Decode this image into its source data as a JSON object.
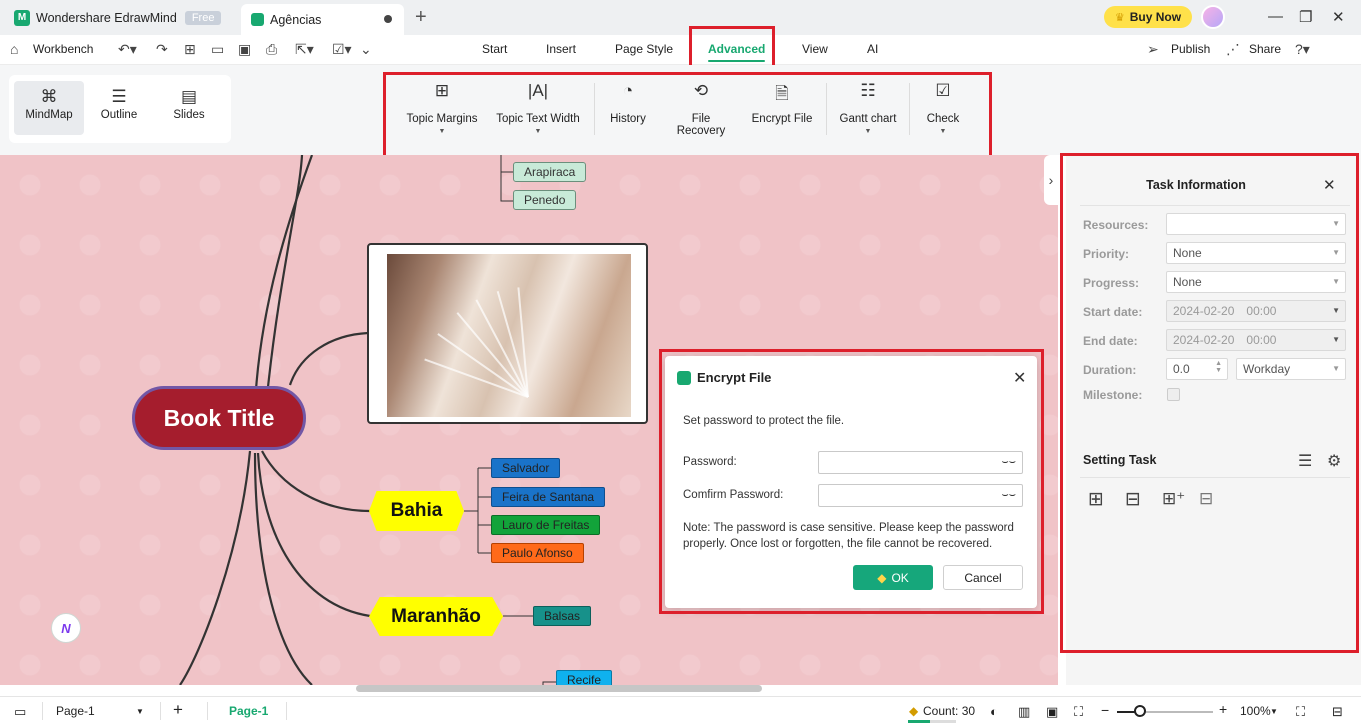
{
  "titlebar": {
    "app_name": "Wondershare EdrawMind",
    "plan_badge": "Free",
    "doc_tab": "Agências",
    "new_tab_icon": "plus-icon",
    "buy_now": "Buy Now"
  },
  "menubar": {
    "workbench": "Workbench",
    "tabs": [
      {
        "label": "Start"
      },
      {
        "label": "Insert"
      },
      {
        "label": "Page Style"
      },
      {
        "label": "Advanced"
      },
      {
        "label": "View"
      },
      {
        "label": "AI"
      }
    ],
    "active_tab": "Advanced",
    "publish": "Publish",
    "share": "Share"
  },
  "ribbon": {
    "views": [
      {
        "label": "MindMap",
        "icon": "mindmap-icon"
      },
      {
        "label": "Outline",
        "icon": "outline-icon"
      },
      {
        "label": "Slides",
        "icon": "slides-icon"
      }
    ],
    "tools": [
      {
        "label": "Topic Margins",
        "icon": "topic-margins-icon"
      },
      {
        "label": "Topic Text Width",
        "icon": "text-width-icon"
      },
      {
        "label": "History",
        "icon": "history-icon"
      },
      {
        "label": "File Recovery",
        "icon": "file-recovery-icon"
      },
      {
        "label": "Encrypt File",
        "icon": "encrypt-file-icon"
      },
      {
        "label": "Gantt chart",
        "icon": "gantt-icon"
      },
      {
        "label": "Check",
        "icon": "check-icon"
      }
    ]
  },
  "mindmap": {
    "central": "Book Title",
    "nodes": {
      "arapiraca": "Arapiraca",
      "penedo": "Penedo",
      "bahia": "Bahia",
      "salvador": "Salvador",
      "feira": "Feira de Santana",
      "lauro": "Lauro de Freitas",
      "paulo": "Paulo Afonso",
      "maranhao": "Maranhão",
      "balsas": "Balsas",
      "recife": "Recife"
    }
  },
  "dialog": {
    "title": "Encrypt File",
    "intro": "Set password to protect the file.",
    "password_label": "Password:",
    "confirm_label": "Comfirm Password:",
    "note_line1": "Note: The password is case sensitive. Please keep the password",
    "note_line2": "properly. Once lost or forgotten, the file cannot be recovered.",
    "ok": "OK",
    "cancel": "Cancel"
  },
  "task_panel": {
    "title": "Task Information",
    "resources_label": "Resources:",
    "resources_value": "",
    "priority_label": "Priority:",
    "priority_value": "None",
    "progress_label": "Progress:",
    "progress_value": "None",
    "start_label": "Start date:",
    "start_date": "2024-02-20",
    "start_time": "00:00",
    "end_label": "End date:",
    "end_date": "2024-02-20",
    "end_time": "00:00",
    "duration_label": "Duration:",
    "duration_value": "0.0",
    "duration_unit": "Workday",
    "milestone_label": "Milestone:",
    "setting_task": "Setting Task"
  },
  "statusbar": {
    "page_select": "Page-1",
    "page_tab": "Page-1",
    "count": "Count: 30",
    "zoom": "100%",
    "zoom_level": 0.24,
    "count_progress": 0.45
  },
  "colors": {
    "accent": "#18a870",
    "highlight_box": "#dd1f2b",
    "canvas_bg": "#f0c3c7",
    "central_topic": "#a51d2d",
    "topic_yellow": "#ffff00"
  }
}
